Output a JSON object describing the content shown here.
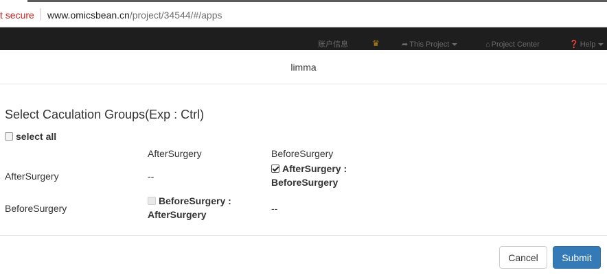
{
  "browser": {
    "security_label": "t secure",
    "url_host": "www.omicsbean.cn",
    "url_path": "/project/34544/#/apps"
  },
  "navbar": {
    "account_info": "账户信息",
    "this_project": "This Project",
    "project_center": "Project Center",
    "help": "Help"
  },
  "modal": {
    "title": "limma",
    "section_title": "Select Caculation Groups(Exp : Ctrl)",
    "select_all_label": "select all",
    "column_headers": [
      "AfterSurgery",
      "BeforeSurgery"
    ],
    "rows": [
      {
        "label": "AfterSurgery",
        "cells": [
          {
            "type": "empty",
            "text": "--"
          },
          {
            "type": "checkbox",
            "checked": true,
            "line1": "AfterSurgery :",
            "line2": "BeforeSurgery"
          }
        ]
      },
      {
        "label": "BeforeSurgery",
        "cells": [
          {
            "type": "checkbox",
            "checked": false,
            "disabled": true,
            "line1": "BeforeSurgery :",
            "line2": "AfterSurgery"
          },
          {
            "type": "empty",
            "text": "--"
          }
        ]
      }
    ],
    "cancel_label": "Cancel",
    "submit_label": "Submit"
  },
  "colors": {
    "primary_button": "#337ab7",
    "navbar_bg": "#1e1e1e",
    "insecure_red": "#c5221f"
  }
}
